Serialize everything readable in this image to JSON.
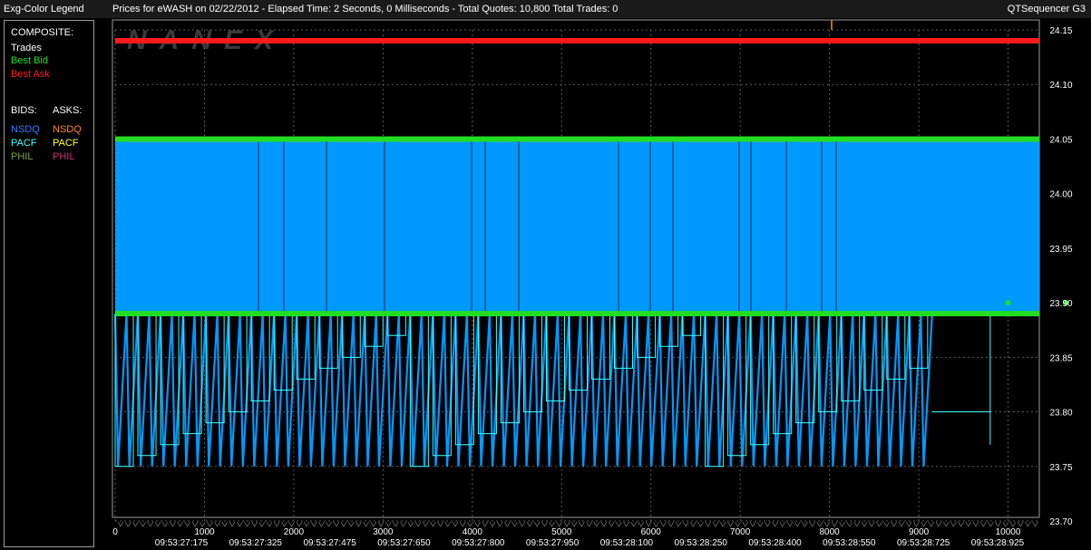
{
  "window": {
    "left_title": "Exg-Color Legend",
    "center_title": "Prices for  eWASH  on  02/22/2012   -  Elapsed Time: 2 Seconds, 0 Milliseconds   -  Total Quotes: 10,800  Total Trades: 0",
    "right_title": "QTSequencer G3"
  },
  "legend": {
    "composite_header": "COMPOSITE:",
    "trades": "Trades",
    "best_bid": "Best Bid",
    "best_ask": "Best Ask",
    "bids_header": "BIDS:",
    "asks_header": "ASKS:",
    "bids": [
      "NSDQ",
      "PACF",
      "PHIL"
    ],
    "asks": [
      "NSDQ",
      "PACF",
      "PHIL"
    ]
  },
  "colors": {
    "trades": "#ffffff",
    "best_bid": "#22dd22",
    "best_ask": "#ff1a1a",
    "nsdq_bid": "#3a7cff",
    "pacf_bid": "#40ffff",
    "phil_bid": "#7aa34a",
    "nsdq_ask": "#ff8c1a",
    "pacf_ask": "#ffff33",
    "phil_ask": "#cc3377",
    "quote_fill": "#0099ff",
    "watermark": "#3a3a3a"
  },
  "watermark": "NANEX",
  "chart_data": {
    "type": "line",
    "title": "Prices for  eWASH  on  02/22/2012",
    "xlabel": "",
    "ylabel": "",
    "xlim": [
      0,
      10350
    ],
    "ylim": [
      23.7,
      24.15
    ],
    "y_ticks": [
      "24.15",
      "24.10",
      "24.05",
      "24.00",
      "23.95",
      "23.90",
      "23.85",
      "23.80",
      "23.75",
      "23.70"
    ],
    "x_ticks": [
      "0",
      "1000",
      "2000",
      "3000",
      "4000",
      "5000",
      "6000",
      "7000",
      "8000",
      "9000",
      "10000"
    ],
    "time_labels": [
      "09:53:27:175",
      "09:53:27:325",
      "09:53:27:475",
      "09:53:27:650",
      "09:53:27:800",
      "09:53:27:950",
      "09:53:28:100",
      "09:53:28:250",
      "09:53:28:400",
      "09:53:28:550",
      "09:53:28:725",
      "09:53:28:925"
    ],
    "grid": true,
    "series": [
      {
        "name": "Best Ask",
        "values": [
          [
            0,
            24.14
          ],
          [
            10350,
            24.14
          ]
        ]
      },
      {
        "name": "Best Bid",
        "values": [
          [
            0,
            23.89
          ],
          [
            10350,
            23.89
          ]
        ]
      }
    ],
    "quote_band": {
      "low": 23.89,
      "high": 24.05,
      "x_end": 10350
    },
    "bid_saw": {
      "x_start": 0,
      "x_end": 9150,
      "low": 23.75,
      "high": 23.89,
      "teeth": 72
    },
    "bid_tail": [
      [
        9150,
        23.8
      ],
      [
        9800,
        23.8
      ],
      [
        9800,
        23.89
      ]
    ],
    "green_dots": [
      [
        10000,
        23.9
      ],
      [
        10650,
        23.9
      ]
    ]
  }
}
